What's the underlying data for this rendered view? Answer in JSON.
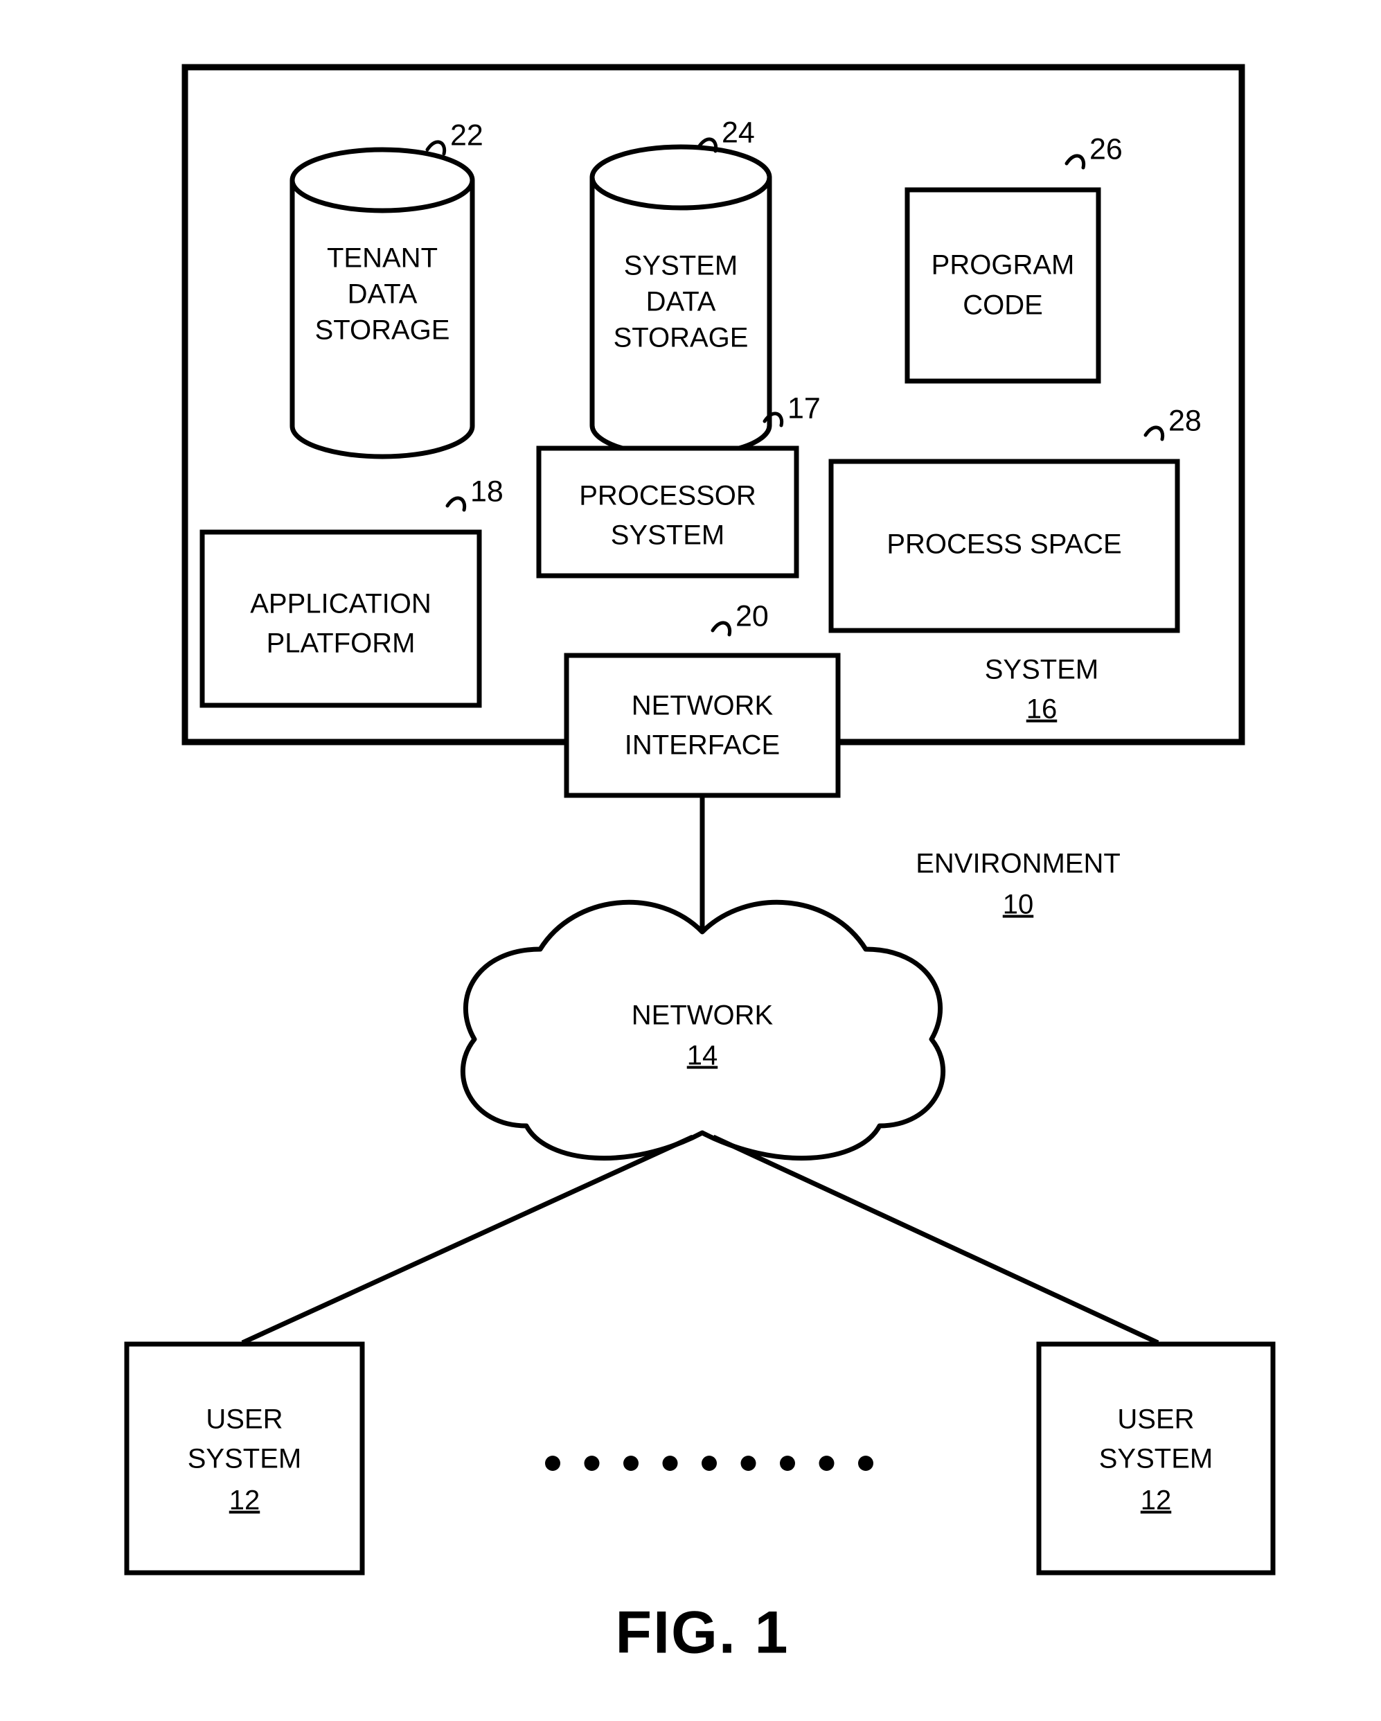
{
  "figure": {
    "caption": "FIG. 1",
    "environment": {
      "label": "ENVIRONMENT",
      "ref": "10"
    },
    "system": {
      "label": "SYSTEM",
      "ref": "16"
    },
    "network": {
      "label": "NETWORK",
      "ref": "14"
    }
  },
  "nodes": {
    "tenant_data_storage": {
      "line1": "TENANT",
      "line2": "DATA",
      "line3": "STORAGE",
      "ref": "22"
    },
    "system_data_storage": {
      "line1": "SYSTEM",
      "line2": "DATA",
      "line3": "STORAGE",
      "ref": "24"
    },
    "program_code": {
      "line1": "PROGRAM",
      "line2": "CODE",
      "ref": "26"
    },
    "processor_system": {
      "line1": "PROCESSOR",
      "line2": "SYSTEM",
      "ref": "17"
    },
    "process_space": {
      "line1": "PROCESS SPACE",
      "ref": "28"
    },
    "application_platform": {
      "line1": "APPLICATION",
      "line2": "PLATFORM",
      "ref": "18"
    },
    "network_interface": {
      "line1": "NETWORK",
      "line2": "INTERFACE",
      "ref": "20"
    },
    "user_system_left": {
      "line1": "USER",
      "line2": "SYSTEM",
      "ref": "12"
    },
    "user_system_right": {
      "line1": "USER",
      "line2": "SYSTEM",
      "ref": "12"
    }
  },
  "ellipsis": {
    "count": 9,
    "glyph": "•"
  },
  "colors": {
    "ink": "#000000",
    "paper": "#ffffff"
  }
}
